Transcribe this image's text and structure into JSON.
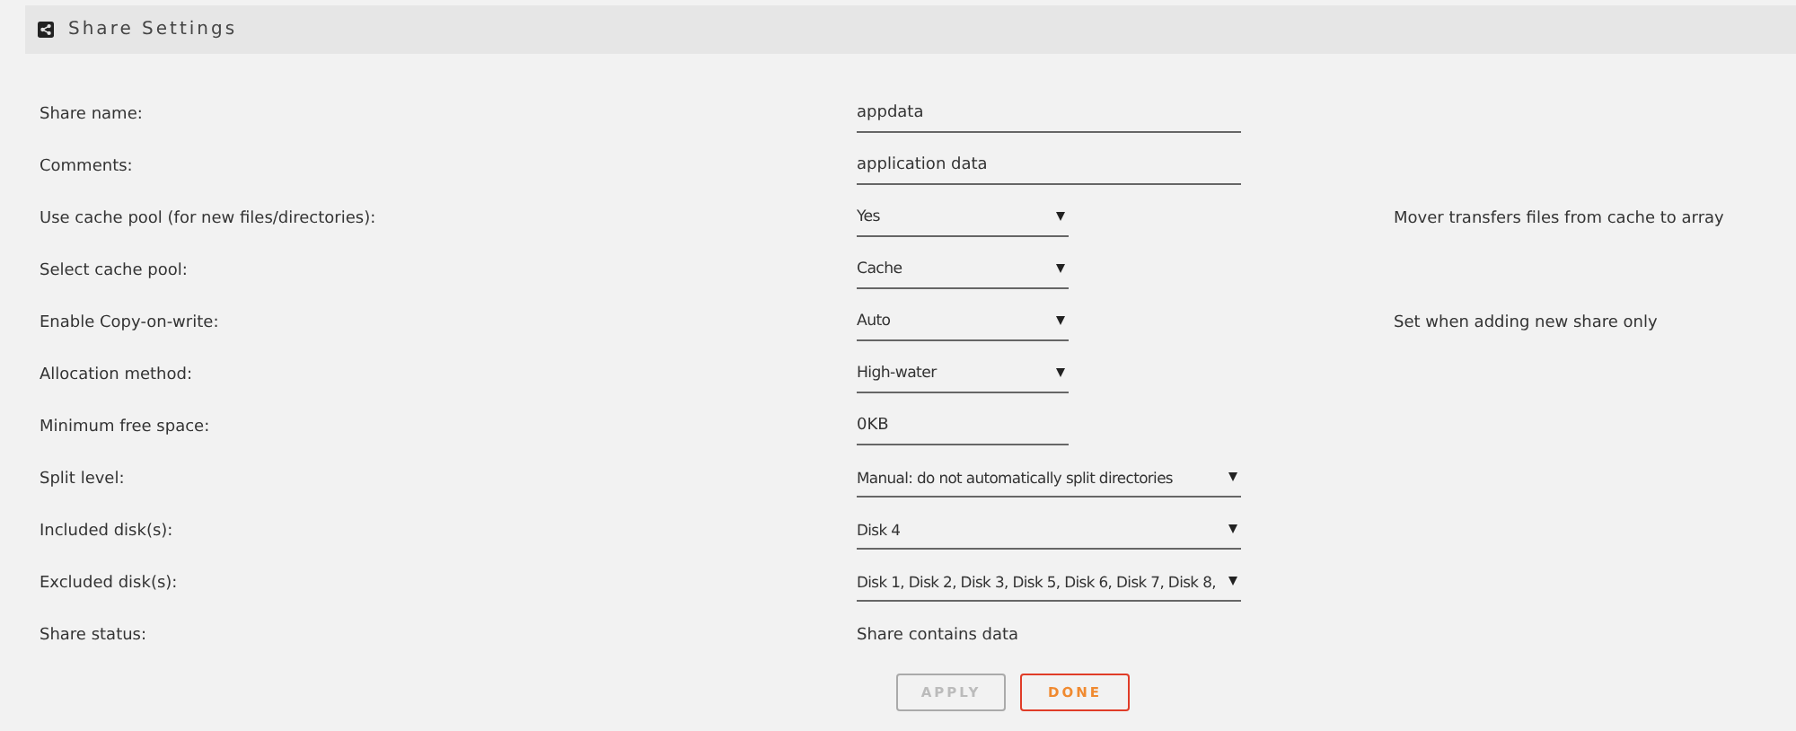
{
  "header": {
    "title": "Share Settings"
  },
  "rows": [
    {
      "label": "Share name:",
      "kind": "wide-input",
      "value": "appdata"
    },
    {
      "label": "Comments:",
      "kind": "wide-input",
      "value": "application data"
    },
    {
      "label": "Use cache pool (for new files/directories):",
      "kind": "select",
      "value": "Yes",
      "note": "Mover transfers files from cache to array"
    },
    {
      "label": "Select cache pool:",
      "kind": "select",
      "value": "Cache"
    },
    {
      "label": "Enable Copy-on-write:",
      "kind": "select",
      "value": "Auto",
      "note": "Set when adding new share only"
    },
    {
      "label": "Allocation method:",
      "kind": "select",
      "value": "High-water"
    },
    {
      "label": "Minimum free space:",
      "kind": "input",
      "value": "0KB"
    },
    {
      "label": "Split level:",
      "kind": "wide-select",
      "value": "Manual: do not automatically split directories"
    },
    {
      "label": "Included disk(s):",
      "kind": "wide-select",
      "value": "Disk 4"
    },
    {
      "label": "Excluded disk(s):",
      "kind": "wide-select",
      "value": "Disk 1, Disk 2, Disk 3, Disk 5, Disk 6, Disk 7, Disk 8,"
    },
    {
      "label": "Share status:",
      "kind": "text",
      "value": "Share contains data"
    }
  ],
  "buttons": [
    {
      "label": "APPLY",
      "disabled": true
    },
    {
      "label": "DONE",
      "disabled": false
    }
  ]
}
